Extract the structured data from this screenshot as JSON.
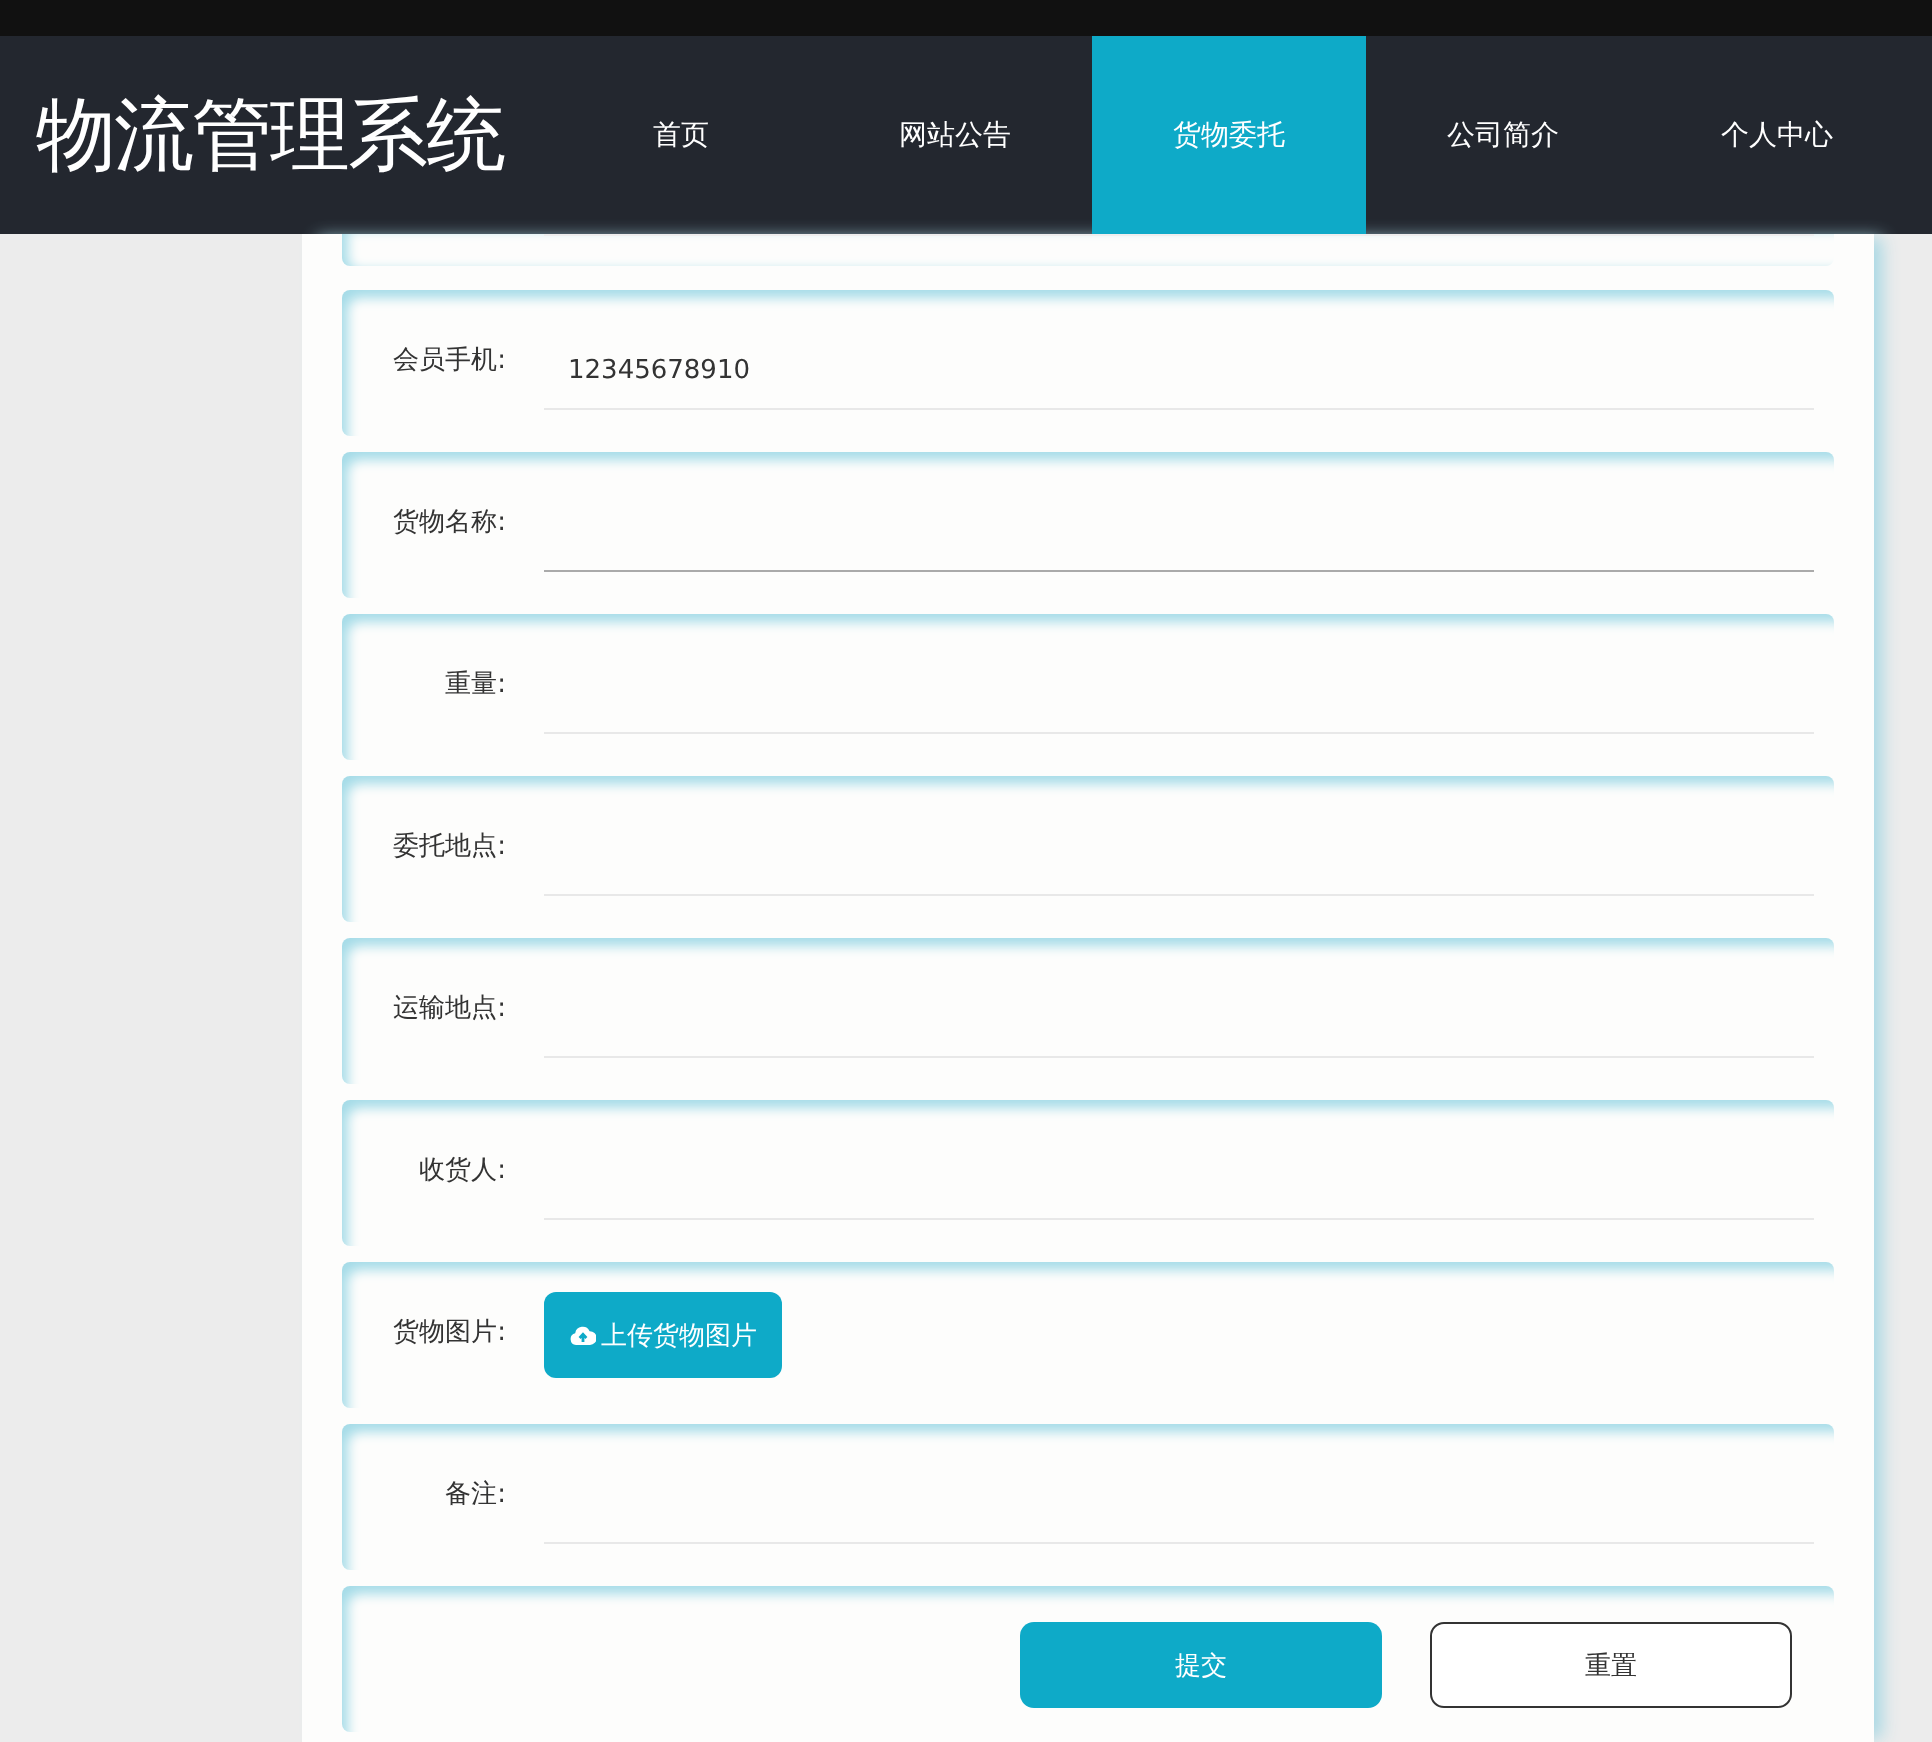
{
  "header": {
    "title": "物流管理系统",
    "nav": [
      {
        "label": "首页",
        "selected": false
      },
      {
        "label": "网站公告",
        "selected": false
      },
      {
        "label": "货物委托",
        "selected": true
      },
      {
        "label": "公司简介",
        "selected": false
      },
      {
        "label": "个人中心",
        "selected": false
      }
    ]
  },
  "form": {
    "rows": [
      {
        "kind": "field",
        "label": "会员手机:",
        "value": "12345678910",
        "focused": false
      },
      {
        "kind": "field",
        "label": "货物名称:",
        "focused": true
      },
      {
        "kind": "field",
        "label": "重量:",
        "focused": false
      },
      {
        "kind": "field",
        "label": "委托地点:",
        "focused": false
      },
      {
        "kind": "field",
        "label": "运输地点:",
        "focused": false
      },
      {
        "kind": "field",
        "label": "收货人:",
        "focused": false
      },
      {
        "kind": "upload",
        "label": "货物图片:",
        "button": "上传货物图片"
      },
      {
        "kind": "field",
        "label": "备注:",
        "focused": false
      },
      {
        "kind": "actions",
        "submit": "提交",
        "reset": "重置"
      }
    ]
  }
}
